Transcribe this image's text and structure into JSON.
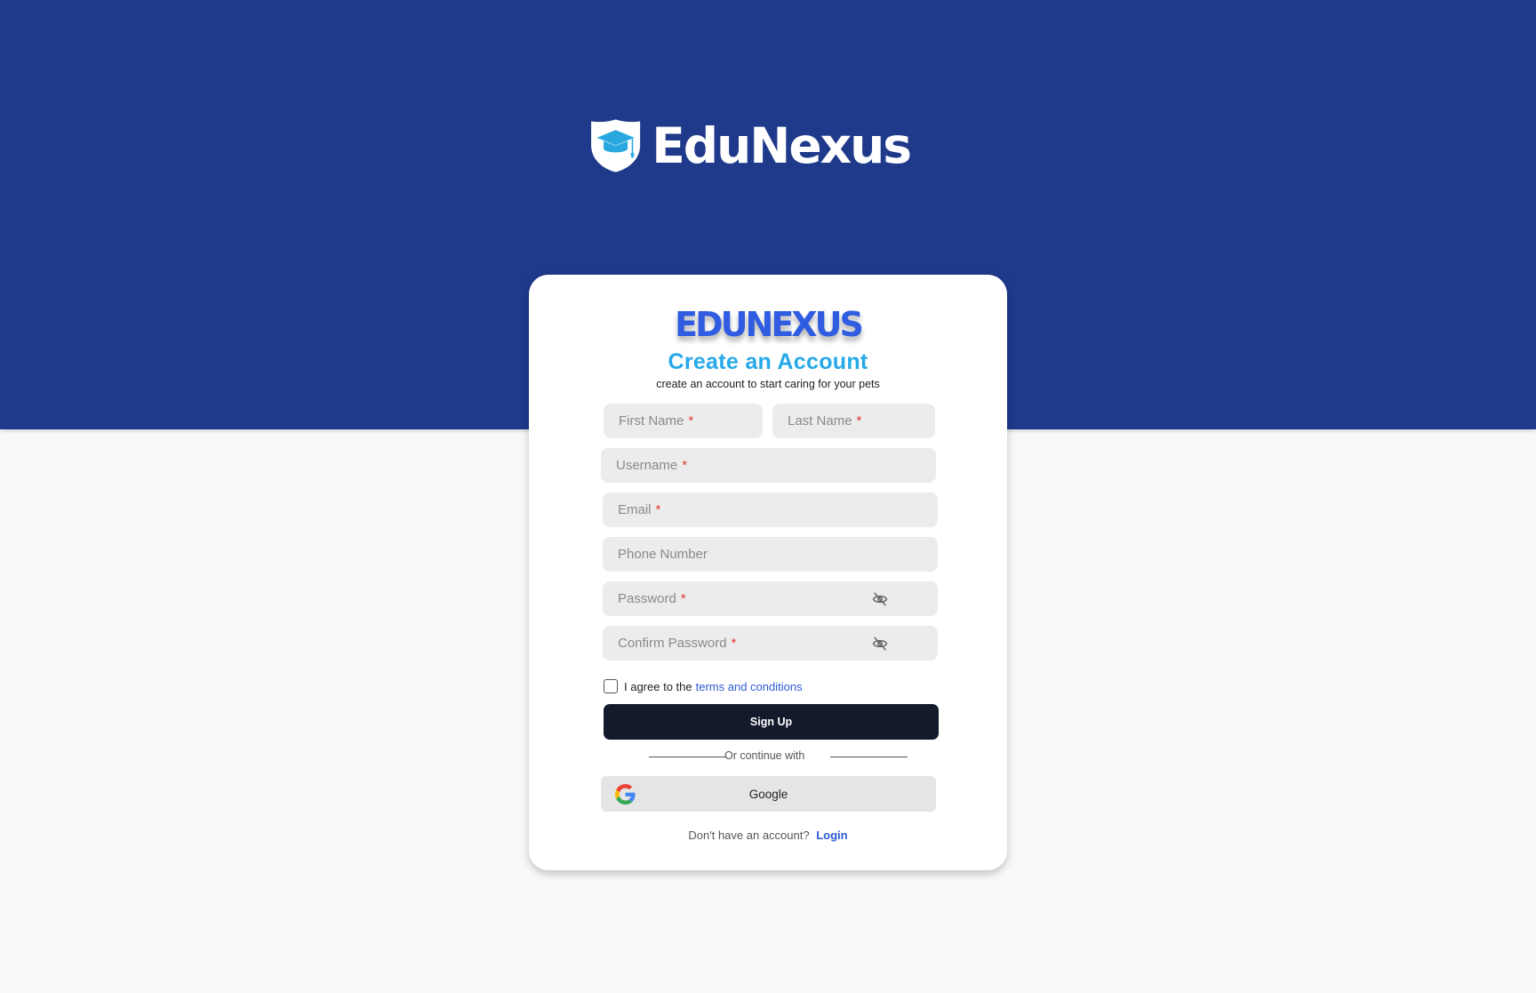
{
  "header": {
    "logo_text": "EduNexus",
    "logo_icon": "graduation-cap-shield-icon"
  },
  "card": {
    "brand": "EDUNEXUS",
    "title": "Create an Account",
    "subtitle": "create an account to start caring for your pets"
  },
  "form": {
    "first_name": {
      "placeholder": "First Name",
      "required": "*"
    },
    "last_name": {
      "placeholder": "Last Name",
      "required": "*"
    },
    "username": {
      "placeholder": "Username",
      "required": "*"
    },
    "email": {
      "placeholder": "Email",
      "required": "*"
    },
    "phone": {
      "placeholder": "Phone Number"
    },
    "password": {
      "placeholder": "Password",
      "required": "*",
      "icon": "eye-off-icon"
    },
    "confirm_password": {
      "placeholder": "Confirm Password",
      "required": "*",
      "icon": "eye-off-icon"
    },
    "terms_prefix": "I agree to the",
    "terms_link": "terms and conditions",
    "submit_label": "Sign Up",
    "divider_text": "Or continue with",
    "google_label": "Google",
    "footer_text": "Don't have an account?",
    "login_link": "Login"
  },
  "colors": {
    "header_bg": "#1f3a8b",
    "page_bg": "#f8f9fb",
    "brand_blue": "#2f5ce0",
    "title_blue": "#27a9e8",
    "link_blue": "#2d5bd4",
    "required_red": "#e53935",
    "button_dark": "#121a2b"
  }
}
